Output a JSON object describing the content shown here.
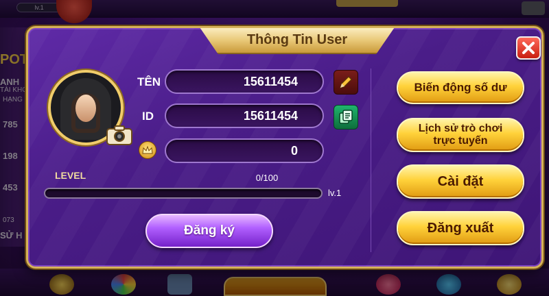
{
  "background": {
    "level_pill": "lv.1",
    "left_panel": [
      "POT",
      "ANH",
      "TÀI KHO",
      "HẠNG",
      "785",
      "198",
      "453",
      "073",
      "SỬ H"
    ]
  },
  "dialog": {
    "title": "Thông Tin User",
    "close_icon": "close-icon"
  },
  "profile": {
    "name_label": "TÊN",
    "name_value": "15611454",
    "id_label": "ID",
    "id_value": "15611454",
    "balance_value": "0",
    "level_label": "LEVEL",
    "level_progress": "0/100",
    "level_fill_fraction": 0.0,
    "level_next": "lv.1",
    "register_button": "Đăng ký"
  },
  "actions": {
    "balance_history": "Biến động số dư",
    "game_history_line1": "Lịch sử trò chơi",
    "game_history_line2": "trực tuyến",
    "settings": "Cài đặt",
    "logout": "Đăng xuất"
  },
  "colors": {
    "dialog_bg": "#4a1d88",
    "gold": "#ffd23a",
    "border_gold": "#d6b25a",
    "close_red": "#c81e10"
  }
}
